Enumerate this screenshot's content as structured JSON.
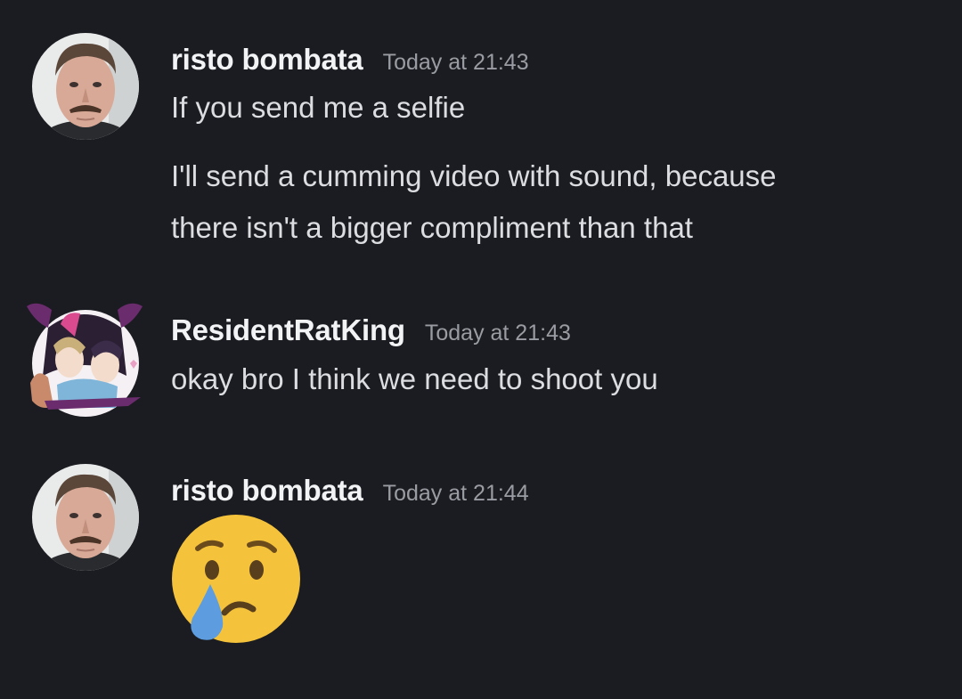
{
  "messages": [
    {
      "author": "risto bombata",
      "timestamp": "Today at 21:43",
      "avatar_icon": "mustache-man-avatar",
      "lines": [
        "If you send me a selfie",
        "I'll send a cumming video with sound, because",
        "there isn't a bigger compliment than that"
      ]
    },
    {
      "author": "ResidentRatKing",
      "timestamp": "Today at 21:43",
      "avatar_icon": "anime-characters-avatar",
      "lines": [
        "okay bro I think we need to shoot you"
      ]
    },
    {
      "author": "risto bombata",
      "timestamp": "Today at 21:44",
      "avatar_icon": "mustache-man-avatar",
      "emoji_icon": "crying-face-emoji"
    }
  ],
  "colors": {
    "background": "#1b1c21",
    "username": "#f2f3f5",
    "timestamp": "#9a9ca3",
    "message_text": "#dcdde1",
    "emoji_face": "#f5c33b",
    "emoji_tear": "#5d9ddf"
  }
}
